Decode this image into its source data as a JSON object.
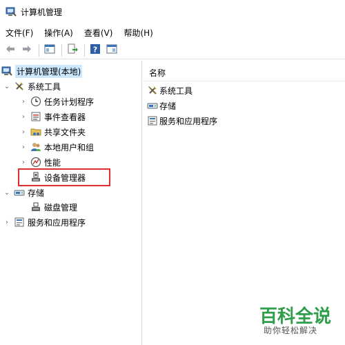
{
  "window": {
    "title": "计算机管理"
  },
  "menu": [
    {
      "label": "文件(F)"
    },
    {
      "label": "操作(A)"
    },
    {
      "label": "查看(V)"
    },
    {
      "label": "帮助(H)"
    }
  ],
  "toolbar": {
    "buttons": [
      {
        "icon": "back-arrow-icon"
      },
      {
        "icon": "forward-arrow-icon"
      },
      {
        "icon": "show-hide-console-tree-icon"
      },
      {
        "icon": "export-list-icon"
      },
      {
        "icon": "help-icon"
      },
      {
        "icon": "show-hide-action-pane-icon"
      }
    ]
  },
  "tree": [
    {
      "label": "计算机管理(本地)",
      "icon": "computer-management-icon",
      "expander": "",
      "selected": true
    },
    {
      "label": "系统工具",
      "icon": "system-tools-icon",
      "expander": "expanded"
    },
    {
      "label": "任务计划程序",
      "icon": "task-scheduler-icon",
      "expander": "collapsed"
    },
    {
      "label": "事件查看器",
      "icon": "event-viewer-icon",
      "expander": "collapsed"
    },
    {
      "label": "共享文件夹",
      "icon": "shared-folders-icon",
      "expander": "collapsed"
    },
    {
      "label": "本地用户和组",
      "icon": "local-users-groups-icon",
      "expander": "collapsed"
    },
    {
      "label": "性能",
      "icon": "performance-icon",
      "expander": "collapsed"
    },
    {
      "label": "设备管理器",
      "icon": "device-manager-icon",
      "expander": ""
    },
    {
      "label": "存储",
      "icon": "storage-icon",
      "expander": "expanded"
    },
    {
      "label": "磁盘管理",
      "icon": "disk-management-icon",
      "expander": ""
    },
    {
      "label": "服务和应用程序",
      "icon": "services-applications-icon",
      "expander": "collapsed"
    }
  ],
  "list": {
    "column_header": "名称",
    "items": [
      {
        "label": "系统工具",
        "icon": "system-tools-icon"
      },
      {
        "label": "存储",
        "icon": "storage-icon"
      },
      {
        "label": "服务和应用程序",
        "icon": "services-applications-icon"
      }
    ]
  },
  "highlight": {
    "target": "设备管理器",
    "color": "#e02e2e"
  },
  "watermark": {
    "main": "百科全说",
    "sub": "助你轻松解决",
    "color": "#2e9e4a"
  },
  "colors": {
    "selection": "#cce8ff",
    "pane_border": "#d9d9d9"
  }
}
